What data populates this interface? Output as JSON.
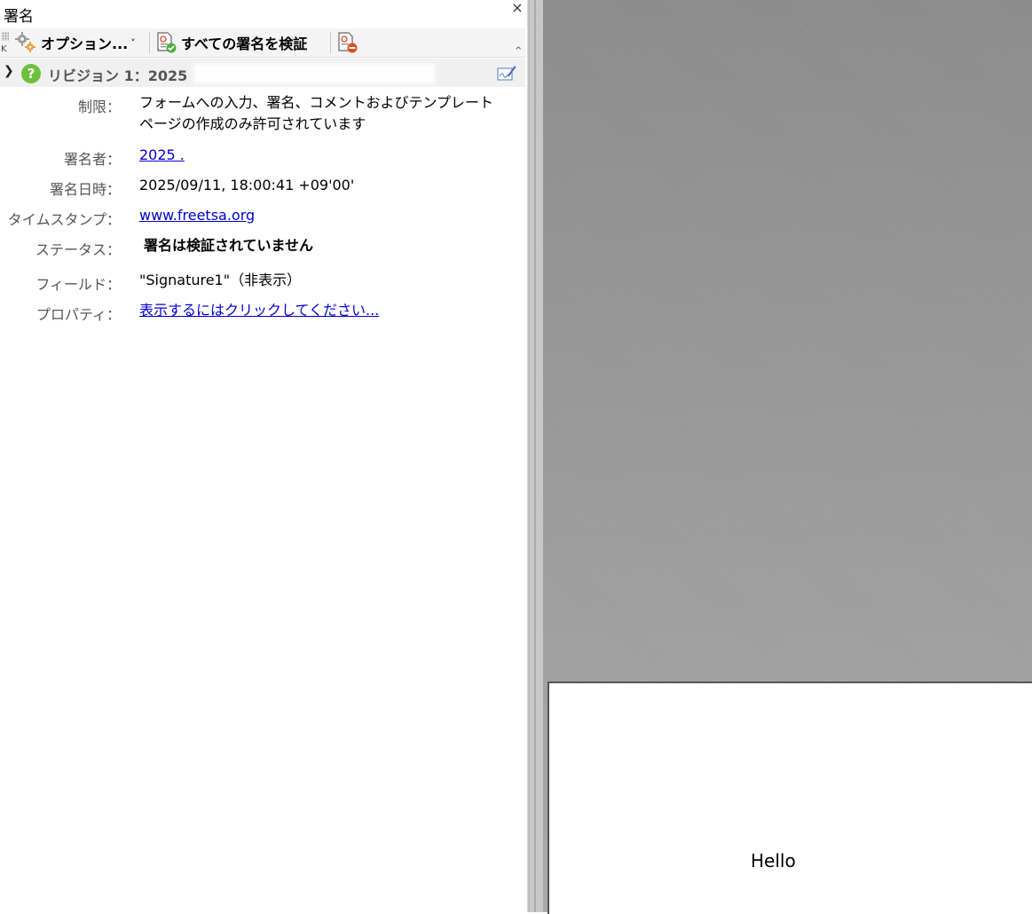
{
  "panel": {
    "title": "署名",
    "close_glyph": "×"
  },
  "toolbar": {
    "options_label": "オプション...",
    "options_arrow": "˅",
    "verify_all_label": "すべての署名を検証",
    "icons": [
      "gear-icon",
      "verify-signature-icon",
      "remove-signature-icon"
    ]
  },
  "revision": {
    "label": "リビジョン 1：2025"
  },
  "properties": {
    "restriction_label": "制限：",
    "restriction_value": "フォームへの入力、署名、コメントおよびテンプレートページの作成のみ許可されています",
    "signer_label": "署名者：",
    "signer_value": "2025 .",
    "signed_time_label": "署名日時：",
    "signed_time_value": "2025/09/11, 18:00:41 +09'00'",
    "timestamp_label": "タイムスタンプ：",
    "timestamp_value": "www.freetsa.org",
    "status_label": "ステータス：",
    "status_value": "署名は検証されていません",
    "field_label": "フィールド：",
    "field_value": "\"Signature1\"（非表示）",
    "properties_label": "プロパティ：",
    "properties_value": "表示するにはクリックしてください..."
  },
  "document": {
    "page_text": "Hello"
  },
  "colors": {
    "link": "#0000cc",
    "help_badge": "#6fbf3c",
    "doc_background": "#9a9a9a"
  }
}
